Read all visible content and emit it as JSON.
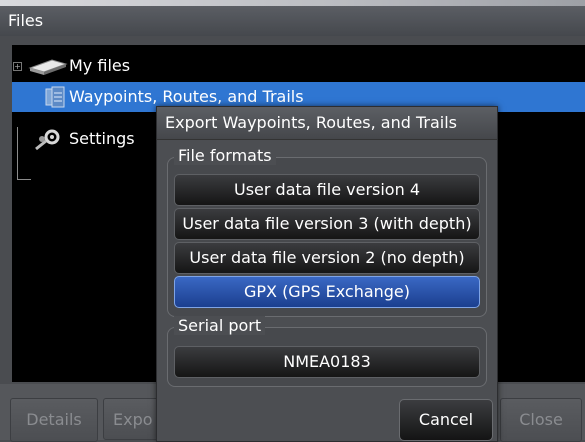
{
  "window": {
    "title": "Files"
  },
  "tree": {
    "items": [
      {
        "label": "My files",
        "icon": "card-icon",
        "expander": "+"
      },
      {
        "label": "Waypoints, Routes, and Trails",
        "icon": "database-icon"
      },
      {
        "label": "Settings",
        "icon": "settings-icon"
      }
    ]
  },
  "bottom_bar": {
    "buttons": [
      {
        "label": "Details"
      },
      {
        "label": "Expo"
      },
      {
        "label": "Close"
      }
    ]
  },
  "dialog": {
    "title": "Export Waypoints, Routes, and Trails",
    "file_formats": {
      "label": "File formats",
      "options": [
        {
          "label": "User data file version 4"
        },
        {
          "label": "User data file version 3 (with depth)"
        },
        {
          "label": "User data file version 2 (no depth)"
        },
        {
          "label": "GPX (GPS Exchange)"
        }
      ],
      "selected": "GPX (GPS Exchange)"
    },
    "serial_port": {
      "label": "Serial port",
      "options": [
        {
          "label": "NMEA0183"
        }
      ]
    },
    "cancel_label": "Cancel"
  },
  "colors": {
    "selection": "#2f76d2",
    "highlight_button": "#2a56b0"
  }
}
